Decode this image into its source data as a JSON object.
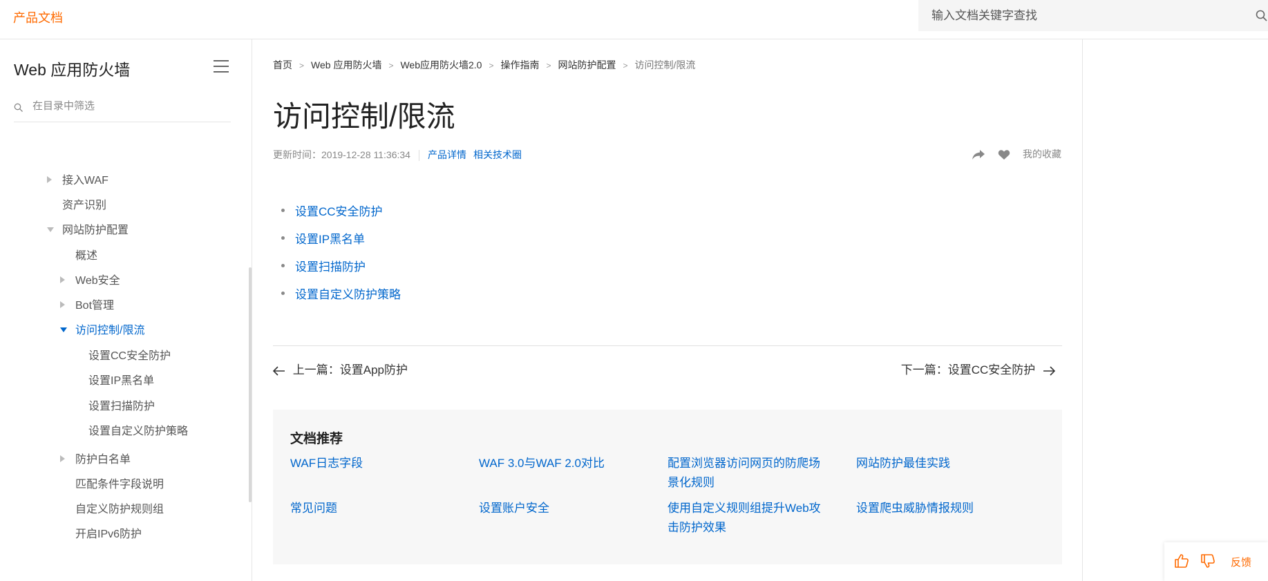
{
  "header": {
    "brand": "产品文档",
    "search_placeholder": "输入文档关键字查找"
  },
  "sidebar": {
    "title": "Web 应用防火墙",
    "filter_placeholder": "在目录中筛选",
    "items": [
      {
        "label": "接入WAF",
        "level": 1,
        "arrow": "right"
      },
      {
        "label": "资产识别",
        "level": 1,
        "arrow": "none"
      },
      {
        "label": "网站防护配置",
        "level": 1,
        "arrow": "down"
      },
      {
        "label": "概述",
        "level": 2,
        "arrow": "none"
      },
      {
        "label": "Web安全",
        "level": 2,
        "arrow": "right"
      },
      {
        "label": "Bot管理",
        "level": 2,
        "arrow": "right"
      },
      {
        "label": "访问控制/限流",
        "level": 2,
        "arrow": "down",
        "active": true
      },
      {
        "label": "设置CC安全防护",
        "level": 3,
        "arrow": "none"
      },
      {
        "label": "设置IP黑名单",
        "level": 3,
        "arrow": "none"
      },
      {
        "label": "设置扫描防护",
        "level": 3,
        "arrow": "none"
      },
      {
        "label": "设置自定义防护策略",
        "level": 3,
        "arrow": "none"
      },
      {
        "label": "防护白名单",
        "level": 2,
        "arrow": "right"
      },
      {
        "label": "匹配条件字段说明",
        "level": 2,
        "arrow": "none"
      },
      {
        "label": "自定义防护规则组",
        "level": 2,
        "arrow": "none"
      },
      {
        "label": "开启IPv6防护",
        "level": 2,
        "arrow": "none"
      }
    ]
  },
  "breadcrumb": [
    "首页",
    "Web 应用防火墙",
    "Web应用防火墙2.0",
    "操作指南",
    "网站防护配置",
    "访问控制/限流"
  ],
  "article": {
    "title": "访问控制/限流",
    "updated": "更新时间：2019-12-28 11:36:34",
    "product_link": "产品详情",
    "tech_link": "相关技术圈",
    "favorite_label": "我的收藏",
    "links": [
      "设置CC安全防护",
      "设置IP黑名单",
      "设置扫描防护",
      "设置自定义防护策略"
    ]
  },
  "pager": {
    "prev": "上一篇：设置App防护",
    "next": "下一篇：设置CC安全防护"
  },
  "recommend": {
    "title": "文档推荐",
    "links": [
      "WAF日志字段",
      "WAF 3.0与WAF 2.0对比",
      "配置浏览器访问网页的防爬场景化规则",
      "网站防护最佳实践",
      "常见问题",
      "设置账户安全",
      "使用自定义规则组提升Web攻击防护效果",
      "设置爬虫威胁情报规则"
    ]
  },
  "feedback": {
    "label": "反馈"
  },
  "colors": {
    "brand": "#ff6a00",
    "link": "#0066cc"
  }
}
